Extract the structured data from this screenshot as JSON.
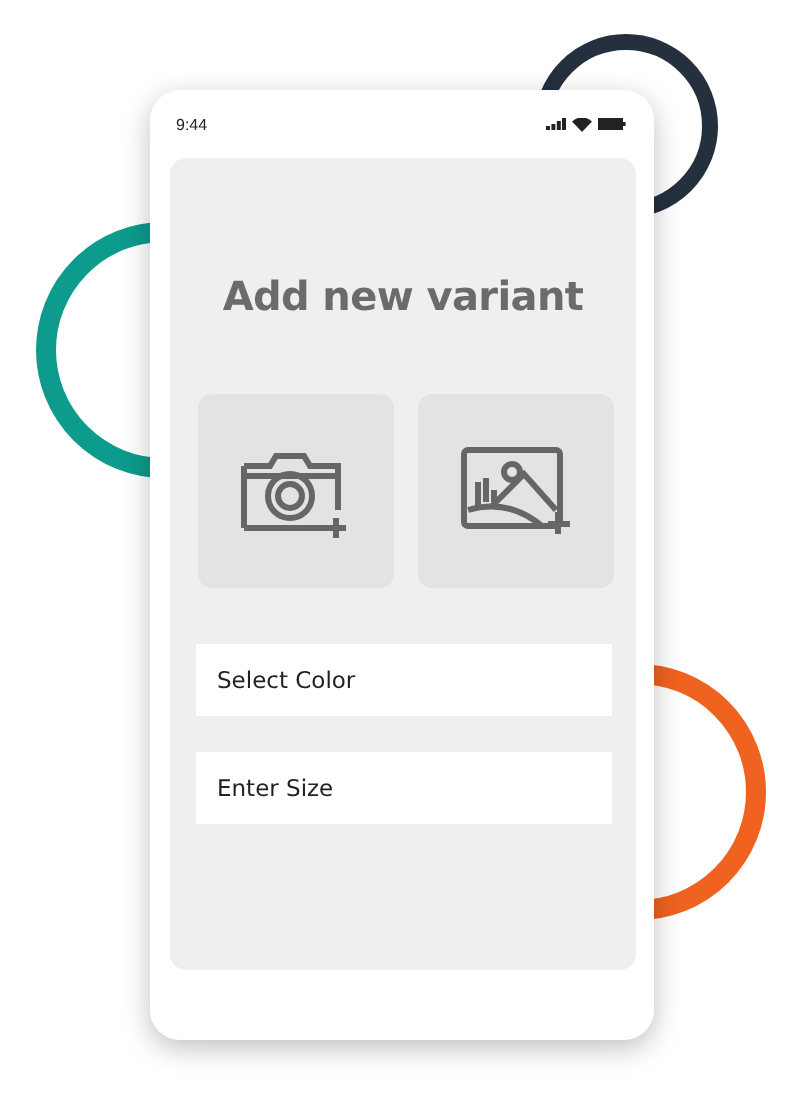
{
  "status_bar": {
    "time": "9:44"
  },
  "title": "Add new variant",
  "media_buttons": [
    {
      "kind": "camera"
    },
    {
      "kind": "gallery"
    }
  ],
  "fields": [
    {
      "placeholder": "Select Color"
    },
    {
      "placeholder": "Enter Size"
    }
  ]
}
